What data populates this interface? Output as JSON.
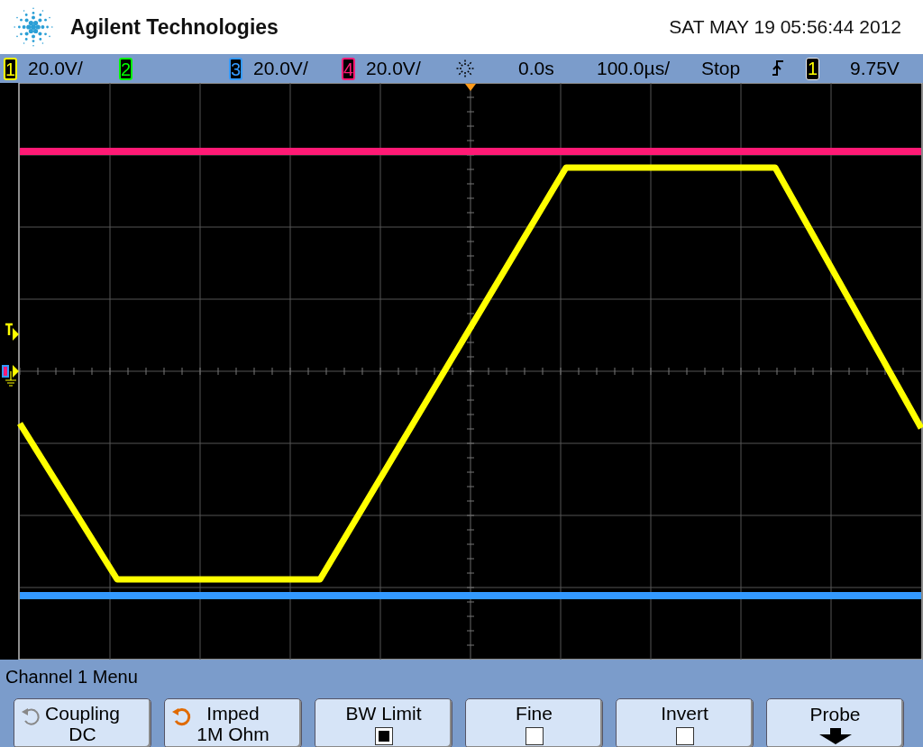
{
  "header": {
    "brand": "Agilent Technologies",
    "datetime": "SAT MAY 19 05:56:44 2012"
  },
  "status_bar": {
    "channels": [
      {
        "number": "1",
        "scale": "20.0V/",
        "color": "#ffff00"
      },
      {
        "number": "2",
        "color": "#00ff00"
      },
      {
        "number": "3",
        "scale": "20.0V/",
        "color": "#3399ff"
      },
      {
        "number": "4",
        "scale": "20.0V/",
        "color": "#ff1a75"
      }
    ],
    "time_offset": "0.0s",
    "time_scale": "100.0µs/",
    "run_state": "Stop",
    "trigger_source": "1",
    "trigger_level": "9.75V"
  },
  "menu": {
    "title": "Channel 1 Menu",
    "softkeys": [
      {
        "kind": "cycle",
        "label": "Coupling",
        "value": "DC",
        "active": false
      },
      {
        "kind": "cycle",
        "label": "Imped",
        "value": "1M Ohm",
        "active": true
      },
      {
        "kind": "checkbox",
        "label": "BW Limit",
        "checked": true
      },
      {
        "kind": "checkbox",
        "label": "Fine",
        "checked": false
      },
      {
        "kind": "checkbox",
        "label": "Invert",
        "checked": false
      },
      {
        "kind": "submenu",
        "label": "Probe"
      }
    ]
  }
}
